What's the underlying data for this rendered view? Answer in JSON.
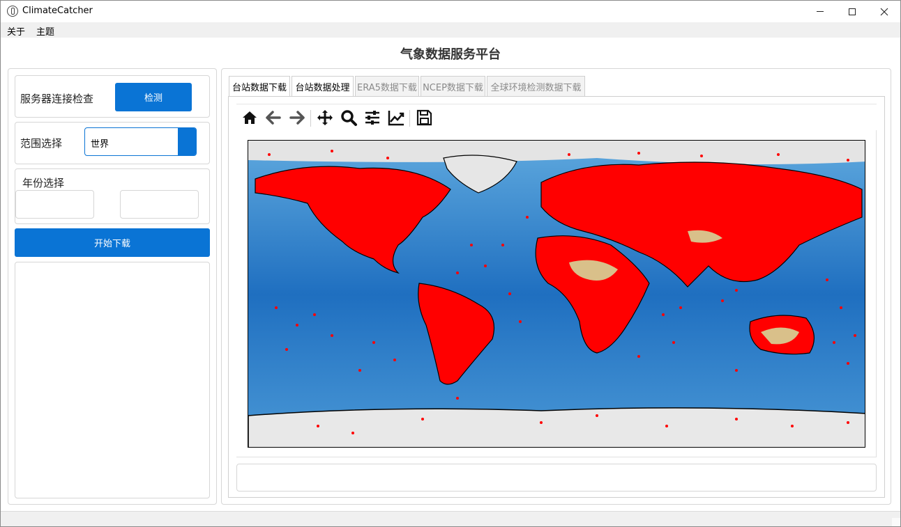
{
  "window": {
    "title": "ClimateCatcher",
    "controls": {
      "minimize": "minimize",
      "maximize": "maximize",
      "close": "close"
    }
  },
  "menubar": {
    "items": [
      {
        "label": "关于"
      },
      {
        "label": "主题"
      }
    ]
  },
  "page": {
    "title": "气象数据服务平台"
  },
  "sidebar": {
    "server_check": {
      "label": "服务器连接检查",
      "button": "检测"
    },
    "range": {
      "label": "范围选择",
      "selected": "世界"
    },
    "year": {
      "label": "年份选择",
      "start": "",
      "end": ""
    },
    "start_button": "开始下载",
    "log_text": ""
  },
  "tabs": [
    {
      "label": "台站数据下载",
      "active": true
    },
    {
      "label": "台站数据处理",
      "active": true
    },
    {
      "label": "ERA5数据下载",
      "active": false
    },
    {
      "label": "NCEP数据下载",
      "active": false
    },
    {
      "label": "全球环境检测数据下载",
      "active": false
    }
  ],
  "plot_toolbar": {
    "icons": [
      "home-icon",
      "back-icon",
      "forward-icon",
      "pan-icon",
      "zoom-icon",
      "configure-subplots-icon",
      "edit-axis-icon",
      "save-icon"
    ]
  },
  "map": {
    "description_colors": {
      "ocean": "#2a7fc9",
      "land": "#d9c08a",
      "ice": "#e8e8e8",
      "station": "#ff0000"
    }
  },
  "status_text": "",
  "colors": {
    "accent": "#0a74d5",
    "station_marker": "#ff0000"
  }
}
